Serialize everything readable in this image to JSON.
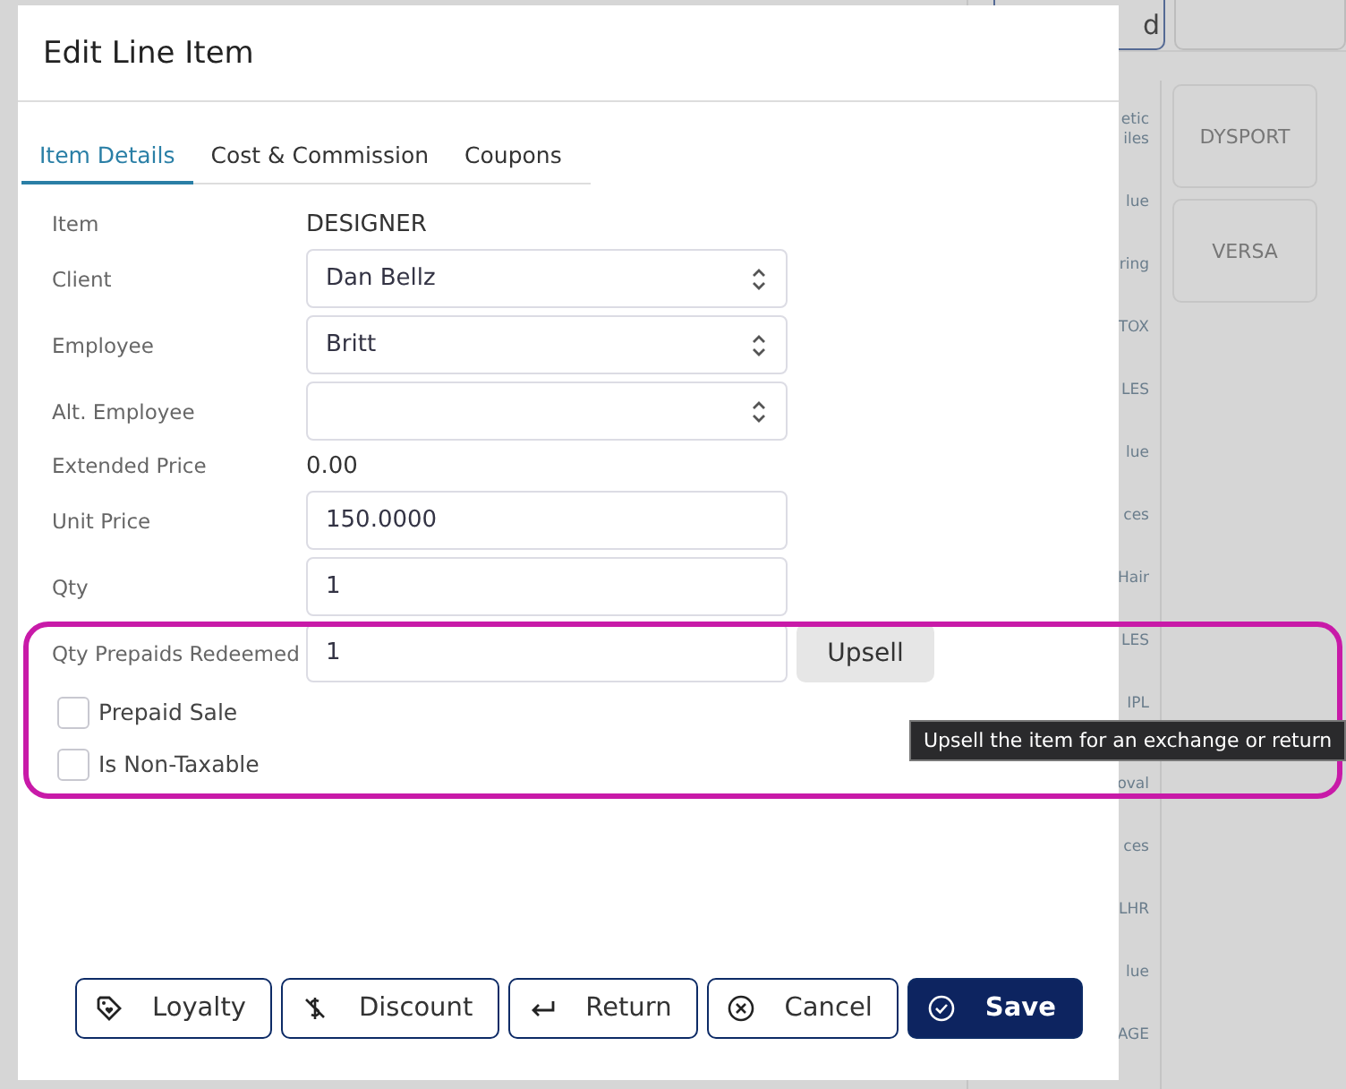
{
  "background": {
    "top_tiles": [
      "d"
    ],
    "categories": [
      "etic iles",
      "lue",
      "ring",
      "TOX",
      "LES",
      "lue",
      "ces",
      "Hair",
      "LES",
      "IPL",
      "oval",
      "ces",
      "LHR",
      "lue",
      "AGE"
    ],
    "product_tiles": [
      "DYSPORT",
      "VERSA"
    ]
  },
  "dialog": {
    "title": "Edit Line Item",
    "tabs": [
      {
        "label": "Item Details",
        "selected": true
      },
      {
        "label": "Cost & Commission",
        "selected": false
      },
      {
        "label": "Coupons",
        "selected": false
      }
    ],
    "fields": [
      {
        "kind": "text",
        "label": "Item",
        "value": "DESIGNER"
      },
      {
        "kind": "select",
        "label": "Client",
        "value": "Dan Bellz"
      },
      {
        "kind": "select",
        "label": "Employee",
        "value": "Britt"
      },
      {
        "kind": "select",
        "label": "Alt. Employee"
      },
      {
        "kind": "text",
        "label": "Extended Price",
        "value": "0.00"
      },
      {
        "kind": "input",
        "label": "Unit Price",
        "value": "150.0000"
      },
      {
        "kind": "input",
        "label": "Qty",
        "value": "1"
      },
      {
        "kind": "input",
        "label": "Qty Prepaids Redeemed",
        "value": "1",
        "action": "Upsell"
      }
    ],
    "checkboxes": [
      {
        "label": "Prepaid Sale",
        "checked": false
      },
      {
        "label": "Is Non-Taxable",
        "checked": false
      }
    ],
    "buttons": [
      {
        "kind": "loyalty",
        "label": "Loyalty",
        "primary": false
      },
      {
        "kind": "discount",
        "label": "Discount",
        "primary": false
      },
      {
        "kind": "return",
        "label": "Return",
        "primary": false
      },
      {
        "kind": "cancel",
        "label": "Cancel",
        "primary": false
      },
      {
        "kind": "save",
        "label": "Save",
        "primary": true
      }
    ]
  },
  "tooltip": "Upsell the item for an exchange or return"
}
